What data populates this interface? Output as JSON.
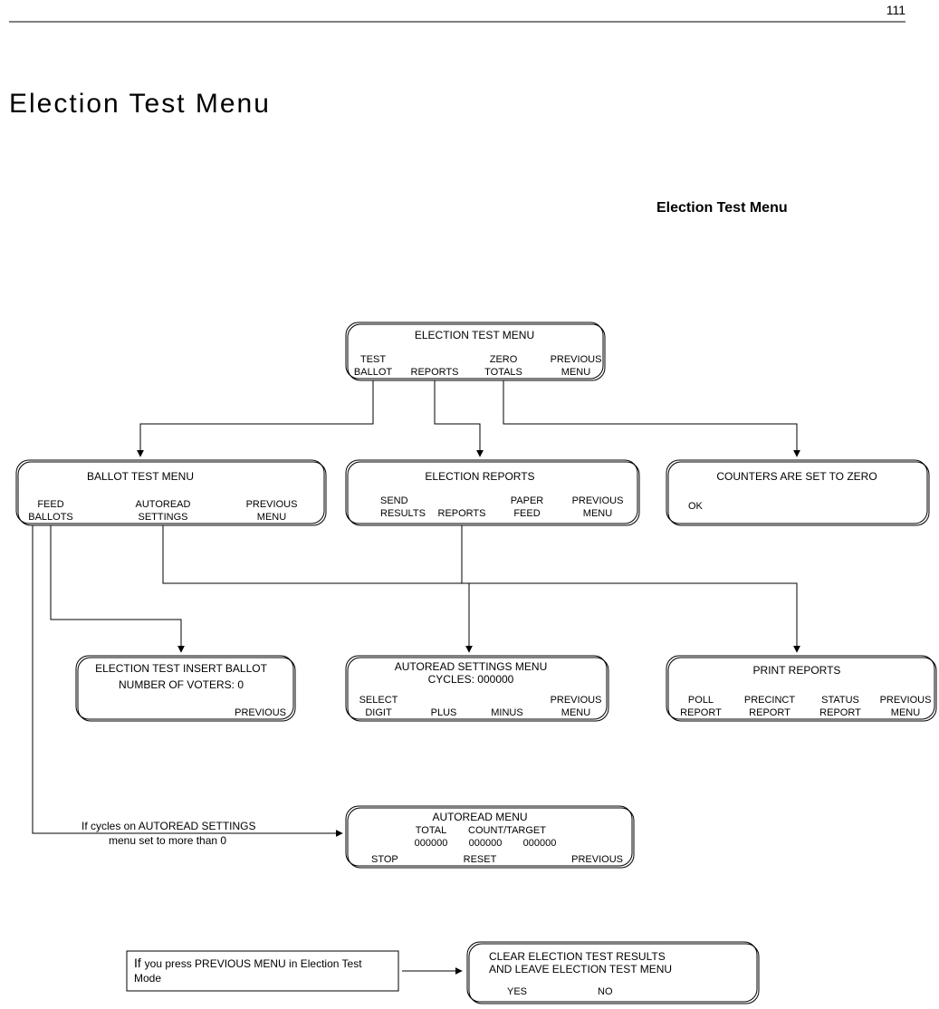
{
  "page_number": "111",
  "title": "Election Test Menu",
  "subtitle": "Election Test Menu",
  "top_menu": {
    "title": "ELECTION TEST MENU",
    "opts": [
      [
        "TEST",
        "BALLOT"
      ],
      [
        "",
        "REPORTS"
      ],
      [
        "ZERO",
        "TOTALS"
      ],
      [
        "PREVIOUS",
        "MENU"
      ]
    ]
  },
  "ballot_test": {
    "title": "BALLOT TEST MENU",
    "opts": [
      [
        "FEED",
        "BALLOTS"
      ],
      [
        "AUTOREAD",
        "SETTINGS"
      ],
      [
        "PREVIOUS",
        "MENU"
      ]
    ]
  },
  "election_reports": {
    "title": "ELECTION REPORTS",
    "opts": [
      [
        "SEND",
        "RESULTS"
      ],
      [
        "",
        "REPORTS"
      ],
      [
        "PAPER",
        "FEED"
      ],
      [
        "PREVIOUS",
        "MENU"
      ]
    ]
  },
  "zero_counters": {
    "title": "COUNTERS ARE SET TO ZERO",
    "ok": "OK"
  },
  "insert_ballot": {
    "l1": "ELECTION TEST INSERT BALLOT",
    "l2": "NUMBER OF VOTERS: 0",
    "prev": "PREVIOUS"
  },
  "autoread_settings": {
    "title": "AUTOREAD SETTINGS MENU",
    "cycles": "CYCLES: 000000",
    "opts": [
      [
        "SELECT",
        "DIGIT"
      ],
      [
        "",
        "PLUS"
      ],
      [
        "",
        "MINUS"
      ],
      [
        "PREVIOUS",
        "MENU"
      ]
    ]
  },
  "print_reports": {
    "title": "PRINT REPORTS",
    "opts": [
      [
        "POLL",
        "REPORT"
      ],
      [
        "PRECINCT",
        "REPORT"
      ],
      [
        "STATUS",
        "REPORT"
      ],
      [
        "PREVIOUS",
        "MENU"
      ]
    ]
  },
  "autoread_menu": {
    "title": "AUTOREAD MENU",
    "h1": "TOTAL",
    "h2": "COUNT/TARGET",
    "v1": "000000",
    "v2": "000000",
    "v3": "000000",
    "opts": [
      "STOP",
      "RESET",
      "PREVIOUS"
    ]
  },
  "clear_box": {
    "l1": "CLEAR ELECTION TEST RESULTS",
    "l2": "AND LEAVE ELECTION TEST MENU",
    "yes": "YES",
    "no": "NO"
  },
  "note_autoread": "If cycles on AUTOREAD SETTINGS\nmenu set to more than 0",
  "note_prev_l1": "If ",
  "note_prev_l2": "you press PREVIOUS MENU in Election Test Mode"
}
